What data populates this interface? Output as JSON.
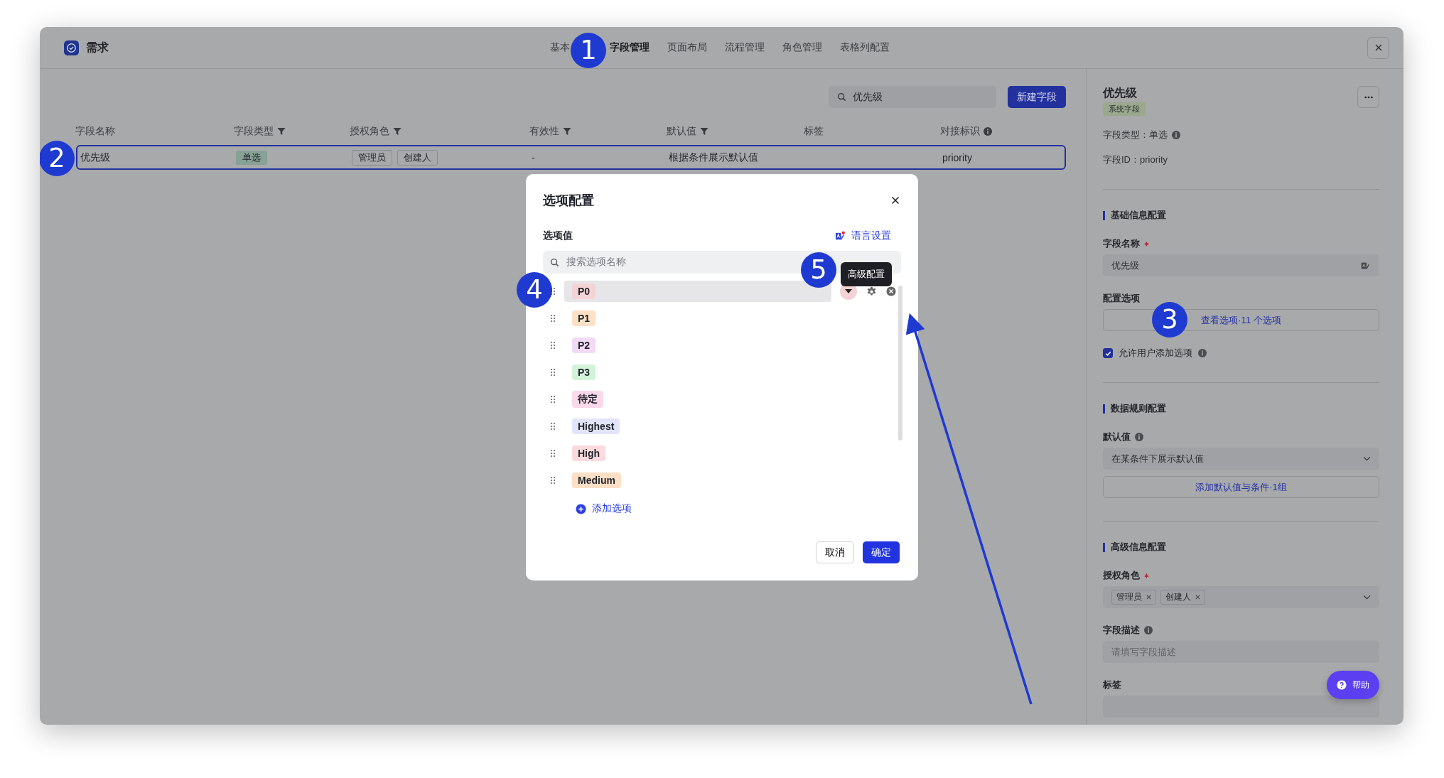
{
  "window": {
    "title": "需求"
  },
  "tabs": [
    {
      "label": "基本",
      "selected": false
    },
    {
      "label": "字段管理",
      "selected": true
    },
    {
      "label": "页面布局",
      "selected": false
    },
    {
      "label": "流程管理",
      "selected": false
    },
    {
      "label": "角色管理",
      "selected": false
    },
    {
      "label": "表格列配置",
      "selected": false
    }
  ],
  "toolbar": {
    "search": {
      "value": "优先级"
    },
    "new_button": "新建字段"
  },
  "table": {
    "columns": [
      {
        "label": "字段名称",
        "kind": "plain"
      },
      {
        "label": "字段类型",
        "kind": "filterable"
      },
      {
        "label": "授权角色",
        "kind": "filterable"
      },
      {
        "label": "有效性",
        "kind": "filterable"
      },
      {
        "label": "默认值",
        "kind": "filterable"
      },
      {
        "label": "标签",
        "kind": "plain"
      },
      {
        "label": "对接标识",
        "kind": "explained"
      }
    ],
    "rows": [
      {
        "selected": true,
        "cells": [
          {
            "kind": "text",
            "text": "优先级"
          },
          {
            "kind": "tag",
            "tags": [
              "单选"
            ]
          },
          {
            "kind": "outline_tags",
            "tags": [
              "管理员",
              "创建人"
            ]
          },
          {
            "kind": "text",
            "text": "-"
          },
          {
            "kind": "text",
            "text": "根据条件展示默认值"
          },
          {
            "kind": "blank"
          },
          {
            "kind": "text",
            "text": "priority"
          }
        ]
      }
    ]
  },
  "dialog": {
    "title": "选项配置",
    "section_label": "选项值",
    "language_link": "语言设置",
    "search": {
      "placeholder": "搜索选项名称"
    },
    "options": [
      {
        "label": "P0",
        "color": "#f3d3d6",
        "hovered": true
      },
      {
        "label": "P1",
        "color": "#fde0c6",
        "hovered": false
      },
      {
        "label": "P2",
        "color": "#f2daf6",
        "hovered": false
      },
      {
        "label": "P3",
        "color": "#d3f2da",
        "hovered": false
      },
      {
        "label": "待定",
        "color": "#fad9ea",
        "hovered": false
      },
      {
        "label": "Highest",
        "color": "#e2e4fb",
        "hovered": false
      },
      {
        "label": "High",
        "color": "#fbdade",
        "hovered": false
      },
      {
        "label": "Medium",
        "color": "#fcdfc6",
        "hovered": false
      }
    ],
    "tooltip": "高级配置",
    "add_option": "添加选项",
    "cancel": "取消",
    "confirm": "确定"
  },
  "detail_panel": {
    "title": "优先级",
    "badge": "系统字段",
    "type_line": "字段类型：单选",
    "id_line": "字段ID：priority",
    "sections": [
      {
        "title": "基础信息配置",
        "items": [
          {
            "kind": "input",
            "label": "字段名称",
            "required": true,
            "value": "优先级",
            "translatable": true
          },
          {
            "kind": "button",
            "label": "配置选项",
            "text": "查看选项·11 个选项"
          },
          {
            "kind": "checkbox",
            "text": "允许用户添加选项",
            "checked": true,
            "info": true
          }
        ]
      },
      {
        "title": "数据规则配置",
        "items": [
          {
            "kind": "select",
            "label": "默认值",
            "info": true,
            "value": "在某条件下展示默认值"
          },
          {
            "kind": "button",
            "text": "添加默认值与条件·1组"
          }
        ]
      },
      {
        "title": "高级信息配置",
        "items": [
          {
            "kind": "tag_select",
            "label": "授权角色",
            "required": true,
            "tags": [
              "管理员",
              "创建人"
            ]
          },
          {
            "kind": "input",
            "label": "字段描述",
            "info": true,
            "placeholder": "请填写字段描述"
          },
          {
            "kind": "input",
            "label": "标签"
          }
        ]
      }
    ],
    "help_button": "帮助"
  },
  "annotations": [
    {
      "number": "1"
    },
    {
      "number": "2"
    },
    {
      "number": "3"
    },
    {
      "number": "4"
    },
    {
      "number": "5"
    }
  ]
}
